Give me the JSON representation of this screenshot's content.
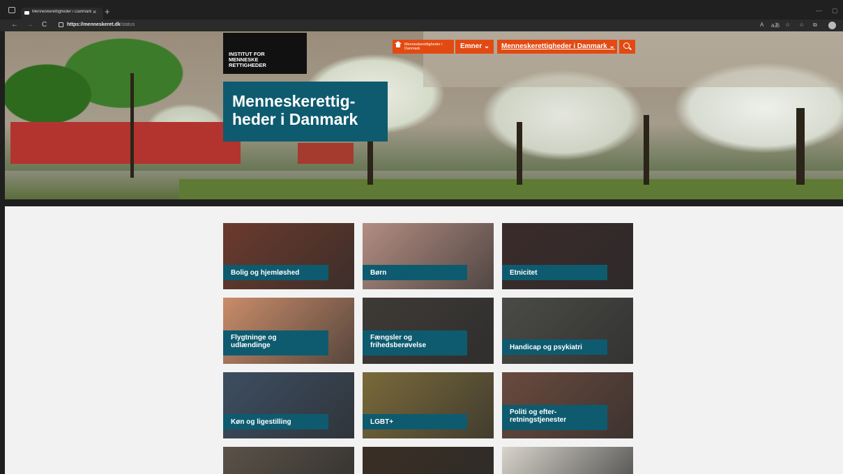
{
  "browser": {
    "tab_title": "Menneskerettigheder i Danmark",
    "tab_close": "×",
    "new_tab": "+",
    "nav_back": "←",
    "nav_forward": "→",
    "nav_refresh": "C",
    "url_domain": "https://menneskeret.dk",
    "url_path": "/status",
    "read_aloud": "A",
    "translate": "aあ",
    "favorites_star": "☆",
    "favorites": "☆",
    "collections": "⧉",
    "minimize": "—",
    "restore": "▢"
  },
  "site": {
    "logo_lines": [
      "INSTITUT FOR",
      "MENNESKE",
      "RETTIGHEDER"
    ],
    "hero_title_lines": [
      "Menneskerettig-",
      "heder i Danmark"
    ],
    "nav_home_label": "Menneskerettigheder i Danmark",
    "nav_emner": "Emner ⌄",
    "nav_dk": "Menneskerettigheder i Danmark ⌄"
  },
  "categories": [
    {
      "label_lines": [
        "Bolig og hjemløshed"
      ],
      "bg": "#6b3a2c"
    },
    {
      "label_lines": [
        "Børn"
      ],
      "bg": "#b28d82"
    },
    {
      "label_lines": [
        "Etnicitet"
      ],
      "bg": "#3a2b2a"
    },
    {
      "label_lines": [
        "Flygtninge og",
        "udlændinge"
      ],
      "bg": "#c98c6a"
    },
    {
      "label_lines": [
        "Fængsler og",
        "frihedsberøvelse"
      ],
      "bg": "#3e3a36"
    },
    {
      "label_lines": [
        "Handicap og psykiatri"
      ],
      "bg": "#4a4a46"
    },
    {
      "label_lines": [
        "Køn og ligestilling"
      ],
      "bg": "#3d4e62"
    },
    {
      "label_lines": [
        "LGBT+"
      ],
      "bg": "#7a6a3a"
    },
    {
      "label_lines": [
        "Politi og efter-",
        "retningstjenester"
      ],
      "bg": "#6a4a3e"
    },
    {
      "label_lines": [],
      "bg": "#5b5248"
    },
    {
      "label_lines": [],
      "bg": "#3b2f24"
    },
    {
      "label_lines": [],
      "bg": "#d8d4cc"
    }
  ]
}
